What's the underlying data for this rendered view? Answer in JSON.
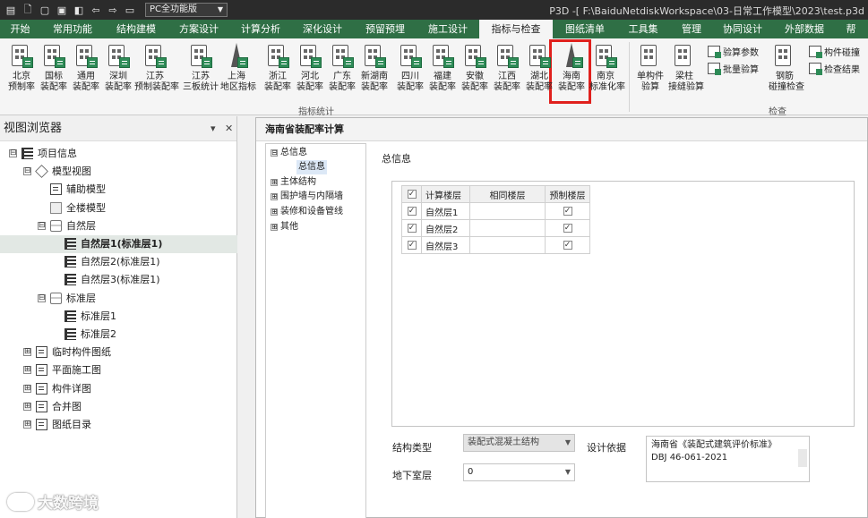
{
  "titlebar": {
    "app_mode": "PC全功能版",
    "title": "P3D -[ F:\\BaiduNetdiskWorkspace\\03-日常工作模型\\2023\\test.p3d"
  },
  "tabs": [
    "开始",
    "常用功能",
    "结构建模",
    "方案设计",
    "计算分析",
    "深化设计",
    "预留预埋",
    "施工设计",
    "指标与检查",
    "图纸清单",
    "工具集",
    "管理",
    "协同设计",
    "外部数据",
    "帮"
  ],
  "ribbon": {
    "buttons": [
      {
        "l1": "北京",
        "l2": "预制率"
      },
      {
        "l1": "国标",
        "l2": "装配率"
      },
      {
        "l1": "通用",
        "l2": "装配率"
      },
      {
        "l1": "深圳",
        "l2": "装配率"
      },
      {
        "l1": "江苏",
        "l2": "预制装配率"
      },
      {
        "l1": "江苏",
        "l2": "三板统计"
      },
      {
        "l1": "上海",
        "l2": "地区指标"
      },
      {
        "l1": "浙江",
        "l2": "装配率"
      },
      {
        "l1": "河北",
        "l2": "装配率"
      },
      {
        "l1": "广东",
        "l2": "装配率"
      },
      {
        "l1": "新湖南",
        "l2": "装配率"
      },
      {
        "l1": "四川",
        "l2": "装配率"
      },
      {
        "l1": "福建",
        "l2": "装配率"
      },
      {
        "l1": "安徽",
        "l2": "装配率"
      },
      {
        "l1": "江西",
        "l2": "装配率"
      },
      {
        "l1": "湖北",
        "l2": "装配率"
      },
      {
        "l1": "海南",
        "l2": "装配率"
      },
      {
        "l1": "南京",
        "l2": "标准化率"
      },
      {
        "l1": "单构件",
        "l2": "验算"
      },
      {
        "l1": "梁柱",
        "l2": "接缝验算"
      },
      {
        "l1": "钢筋",
        "l2": "碰撞检查"
      }
    ],
    "small_buttons": [
      "验算参数",
      "批量验算",
      "构件碰撞",
      "检查结果"
    ],
    "group_indicators": "指标统计",
    "group_check": "检查"
  },
  "view_browser": {
    "title": "视图浏览器",
    "pin": "▾",
    "close": "✕",
    "tree": [
      {
        "label": "项目信息",
        "expander": "⊟"
      },
      {
        "label": "模型视图",
        "expander": "⊟"
      },
      {
        "label": "辅助模型",
        "expander": ""
      },
      {
        "label": "全楼模型",
        "expander": ""
      },
      {
        "label": "自然层",
        "expander": "⊟"
      },
      {
        "label": "自然层1(标准层1)",
        "expander": ""
      },
      {
        "label": "自然层2(标准层1)",
        "expander": ""
      },
      {
        "label": "自然层3(标准层1)",
        "expander": ""
      },
      {
        "label": "标准层",
        "expander": "⊟"
      },
      {
        "label": "标准层1",
        "expander": ""
      },
      {
        "label": "标准层2",
        "expander": ""
      },
      {
        "label": "临时构件图纸",
        "expander": "⊞"
      },
      {
        "label": "平面施工图",
        "expander": "⊞"
      },
      {
        "label": "构件详图",
        "expander": "⊞"
      },
      {
        "label": "合并图",
        "expander": "⊞"
      },
      {
        "label": "图纸目录",
        "expander": "⊞"
      }
    ]
  },
  "dialog": {
    "title": "海南省装配率计算",
    "nav": [
      {
        "label": "总信息",
        "exp": "⊟"
      },
      {
        "label": "总信息",
        "exp": ""
      },
      {
        "label": "主体结构",
        "exp": "⊞"
      },
      {
        "label": "围护墙与内隔墙",
        "exp": "⊞"
      },
      {
        "label": "装修和设备管线",
        "exp": "⊞"
      },
      {
        "label": "其他",
        "exp": "⊞"
      }
    ],
    "section_title": "总信息",
    "table": {
      "headers": [
        "计算楼层",
        "相同楼层",
        "预制楼层"
      ],
      "rows": [
        {
          "floor": "自然层1",
          "same": "",
          "prefab": "✓",
          "checked": "✓"
        },
        {
          "floor": "自然层2",
          "same": "",
          "prefab": "✓",
          "checked": "✓"
        },
        {
          "floor": "自然层3",
          "same": "",
          "prefab": "✓",
          "checked": "✓"
        }
      ],
      "header_check": "✓"
    },
    "structure_type_label": "结构类型",
    "structure_type_value": "装配式混凝土结构",
    "basement_label": "地下室层",
    "basement_value": "0",
    "design_basis_label": "设计依据",
    "design_basis_line1": "海南省《装配式建筑评价标准》",
    "design_basis_line2": "DBJ 46-061-2021"
  },
  "watermark": "大数跨境"
}
